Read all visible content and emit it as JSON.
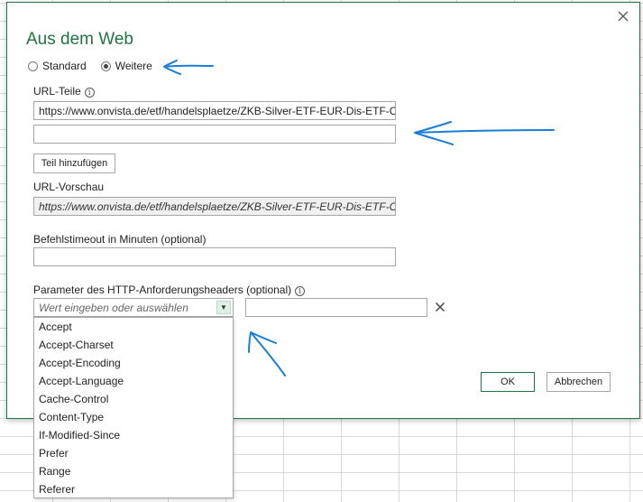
{
  "dialog": {
    "title": "Aus dem Web",
    "mode": {
      "standard_label": "Standard",
      "advanced_label": "Weitere",
      "selected": "Weitere"
    },
    "url_parts": {
      "label": "URL-Teile",
      "part1_value": "https://www.onvista.de/etf/handelsplaetze/ZKB-Silver-ETF-EUR-Dis-ETF-CH",
      "part2_value": "",
      "add_part_label": "Teil hinzufügen"
    },
    "url_preview": {
      "label": "URL-Vorschau",
      "value": "https://www.onvista.de/etf/handelsplaetze/ZKB-Silver-ETF-EUR-Dis-ETF-CHO"
    },
    "timeout": {
      "label": "Befehlstimeout in Minuten (optional)",
      "value": ""
    },
    "headers": {
      "label": "Parameter des HTTP-Anforderungsheaders (optional)",
      "name_placeholder": "Wert eingeben oder auswählen",
      "value": "",
      "options": [
        "Accept",
        "Accept-Charset",
        "Accept-Encoding",
        "Accept-Language",
        "Cache-Control",
        "Content-Type",
        "If-Modified-Since",
        "Prefer",
        "Range",
        "Referer"
      ]
    },
    "ok_label": "OK",
    "cancel_label": "Abbrechen"
  },
  "colors": {
    "accent": "#217346",
    "annotation": "#1a7fd4"
  }
}
